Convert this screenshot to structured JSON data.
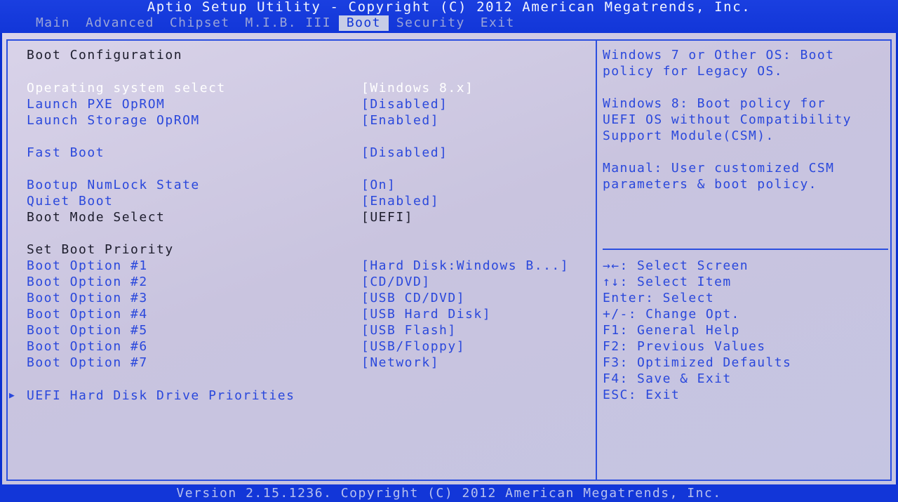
{
  "title": "Aptio Setup Utility - Copyright (C) 2012 American Megatrends, Inc.",
  "tabs": [
    {
      "label": "Main"
    },
    {
      "label": "Advanced"
    },
    {
      "label": "Chipset"
    },
    {
      "label": "M.I.B. III"
    },
    {
      "label": "Boot"
    },
    {
      "label": "Security"
    },
    {
      "label": "Exit"
    }
  ],
  "active_tab": "Boot",
  "section_title": "Boot Configuration",
  "settings": {
    "os_select": {
      "label": "Operating system select",
      "value": "[Windows 8.x]"
    },
    "pxe": {
      "label": "Launch PXE OpROM",
      "value": "[Disabled]"
    },
    "storage": {
      "label": "Launch Storage OpROM",
      "value": "[Enabled]"
    },
    "fast_boot": {
      "label": "Fast Boot",
      "value": "[Disabled]"
    },
    "numlock": {
      "label": "Bootup NumLock State",
      "value": "[On]"
    },
    "quiet_boot": {
      "label": "Quiet Boot",
      "value": "[Enabled]"
    },
    "boot_mode": {
      "label": "Boot Mode Select",
      "value": "[UEFI]"
    }
  },
  "priority_title": "Set Boot Priority",
  "boot_options": [
    {
      "label": "Boot Option #1",
      "value": "[Hard Disk:Windows B...]"
    },
    {
      "label": "Boot Option #2",
      "value": "[CD/DVD]"
    },
    {
      "label": "Boot Option #3",
      "value": "[USB CD/DVD]"
    },
    {
      "label": "Boot Option #4",
      "value": "[USB Hard Disk]"
    },
    {
      "label": "Boot Option #5",
      "value": "[USB Flash]"
    },
    {
      "label": "Boot Option #6",
      "value": "[USB/Floppy]"
    },
    {
      "label": "Boot Option #7",
      "value": "[Network]"
    }
  ],
  "submenu": {
    "label": "UEFI Hard Disk Drive Priorities",
    "icon": "right-triangle-icon"
  },
  "help_text": [
    "Windows 7 or Other OS: Boot",
    "policy for Legacy OS.",
    "Windows 8: Boot policy for",
    "UEFI OS without Compatibility",
    "Support Module(CSM).",
    "Manual: User customized CSM",
    "parameters & boot policy."
  ],
  "key_help": [
    "→←: Select Screen",
    "↑↓: Select Item",
    "Enter: Select",
    "+/-: Change Opt.",
    "F1: General Help",
    "F2: Previous Values",
    "F3: Optimized Defaults",
    "F4: Save & Exit",
    "ESC: Exit"
  ],
  "footer": "Version 2.15.1236. Copyright (C) 2012 American Megatrends, Inc.",
  "colors": {
    "bar_blue": "#1236d8",
    "panel_bg": "#cfcbe4",
    "item_blue": "#2a48dc",
    "selected_white": "#ffffff"
  }
}
